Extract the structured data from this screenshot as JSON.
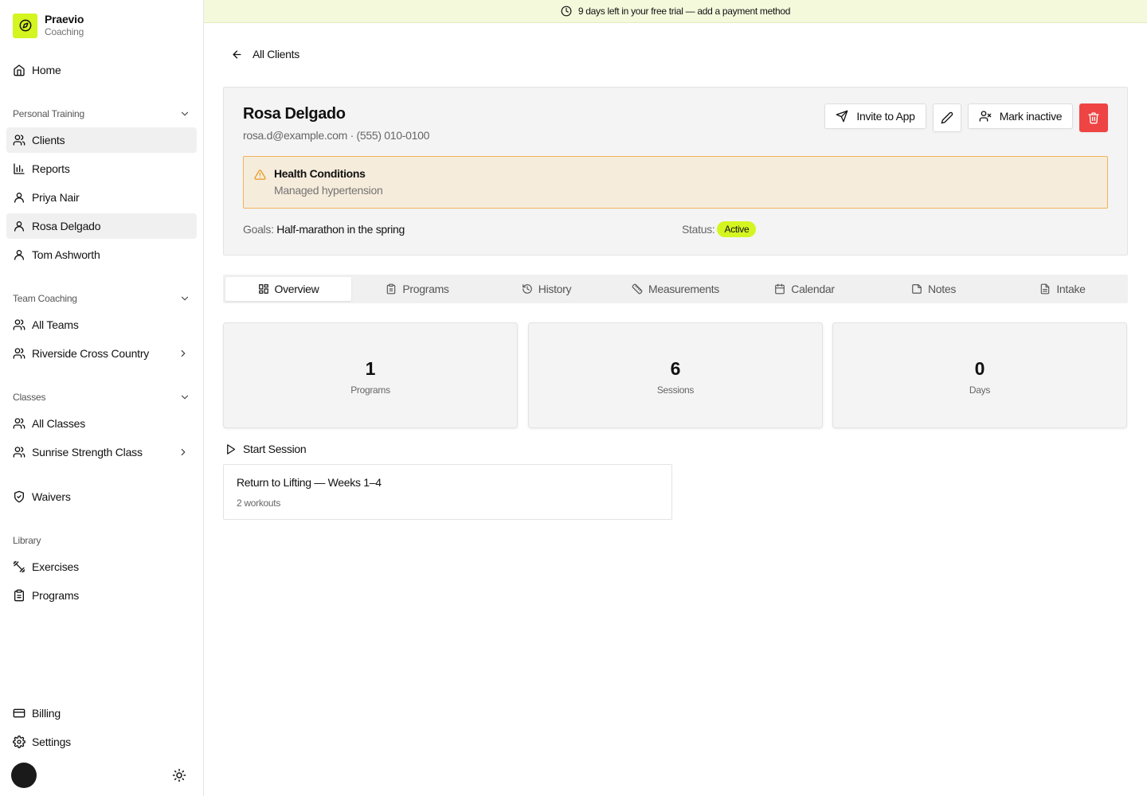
{
  "brand": {
    "name": "Praevio",
    "subtitle": "Coaching"
  },
  "banner": {
    "text": "9 days left in your free trial — add a payment method"
  },
  "sidebar": {
    "home": "Home",
    "personal_training": {
      "label": "Personal Training",
      "items": [
        "Clients",
        "Reports",
        "Priya Nair",
        "Rosa Delgado",
        "Tom Ashworth"
      ]
    },
    "team_coaching": {
      "label": "Team Coaching",
      "items": [
        "All Teams",
        "Riverside Cross Country"
      ]
    },
    "classes": {
      "label": "Classes",
      "items": [
        "All Classes",
        "Sunrise Strength Class"
      ]
    },
    "waivers": "Waivers",
    "library": {
      "label": "Library",
      "items": [
        "Exercises",
        "Programs"
      ]
    },
    "billing": "Billing",
    "settings": "Settings"
  },
  "main": {
    "back_label": "All Clients",
    "client": {
      "name": "Rosa Delgado",
      "contact": "rosa.d@example.com · (555) 010-0100",
      "health": {
        "title": "Health Conditions",
        "description": "Managed hypertension"
      },
      "goals_label": "Goals:",
      "goals_value": "Half-marathon in the spring",
      "status_label": "Status:",
      "status_value": "Active"
    },
    "actions": {
      "invite": "Invite to App",
      "mark_inactive": "Mark inactive"
    },
    "tabs": [
      "Overview",
      "Programs",
      "History",
      "Measurements",
      "Calendar",
      "Notes",
      "Intake"
    ],
    "active_tab": "Overview",
    "stats": [
      {
        "value": "1",
        "label": "Programs"
      },
      {
        "value": "6",
        "label": "Sessions"
      },
      {
        "value": "0",
        "label": "Days"
      }
    ],
    "start_session": "Start Session",
    "program": {
      "title": "Return to Lifting — Weeks 1–4",
      "meta": "2 workouts"
    }
  },
  "colors": {
    "accent": "#d4f520",
    "danger": "#ef4444",
    "warning_bg": "#f6ecdc",
    "warning_border": "#f0b35b",
    "banner_bg": "#f4f9dc"
  }
}
